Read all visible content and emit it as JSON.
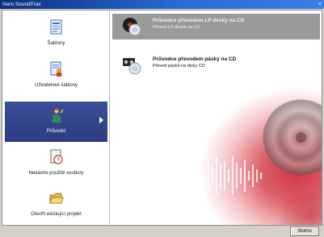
{
  "window": {
    "title": "Nero SoundTrax",
    "close_glyph": "×"
  },
  "sidebar": {
    "items": [
      {
        "label": "Šablony",
        "icon": "template-icon",
        "active": false
      },
      {
        "label": "Uživatelské šablony",
        "icon": "user-template-icon",
        "active": false
      },
      {
        "label": "Průvodci",
        "icon": "wizard-icon",
        "active": true
      },
      {
        "label": "Nedávno použité soubory",
        "icon": "recent-files-icon",
        "active": false
      },
      {
        "label": "Otevřít existující projekt",
        "icon": "open-folder-icon",
        "active": false
      }
    ]
  },
  "options": [
    {
      "title": "Průvodce převodem LP desky na CD",
      "subtitle": "Převod LP desek na CD",
      "icon": "lp-to-cd-icon",
      "selected": true
    },
    {
      "title": "Průvodce převodem pásky na CD",
      "subtitle": "Převod pásků na disky CD",
      "icon": "tape-to-cd-icon",
      "selected": false
    }
  ],
  "footer": {
    "cancel_label": "Storno"
  },
  "colors": {
    "sidebar_active": "#34458a",
    "selected_option": "#9a9a9a",
    "splash_accent": "#ce283a"
  }
}
